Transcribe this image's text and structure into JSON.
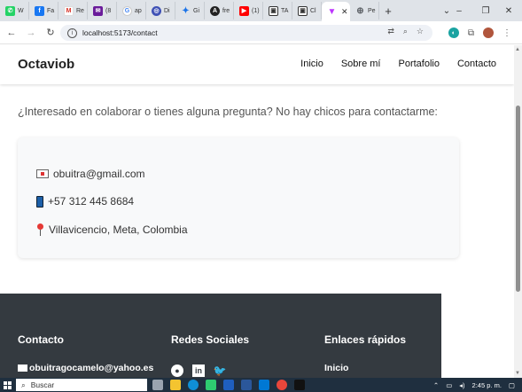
{
  "browser": {
    "tabs": [
      {
        "label": "W",
        "icon": "whatsapp-icon",
        "color": "#25d366"
      },
      {
        "label": "Fa",
        "icon": "facebook-icon",
        "color": "#1877f2"
      },
      {
        "label": "Re",
        "icon": "gmail-icon",
        "color": "#d93025"
      },
      {
        "label": "(8",
        "icon": "mail-icon",
        "color": "#6a1b9a"
      },
      {
        "label": "ap",
        "icon": "google-icon",
        "color": "#4285f4"
      },
      {
        "label": "Di",
        "icon": "site-icon",
        "color": "#3f51b5"
      },
      {
        "label": "Gi",
        "icon": "gemini-icon",
        "color": "#1a73e8"
      },
      {
        "label": "fre",
        "icon": "app-icon",
        "color": "#222222"
      },
      {
        "label": "(1)",
        "icon": "youtube-icon",
        "color": "#ff0000"
      },
      {
        "label": "TA",
        "icon": "doc-icon",
        "color": "#333333"
      },
      {
        "label": "Cl",
        "icon": "doc-icon",
        "color": "#333333"
      },
      {
        "label": "",
        "icon": "vite-icon",
        "color": "#bd34fe",
        "active": true
      },
      {
        "label": "Pe",
        "icon": "globe-icon",
        "color": "#5f6368"
      }
    ],
    "new_tab": "+",
    "window_controls": {
      "chevron": "⌄",
      "minimize": "–",
      "restore": "❐",
      "close": "✕"
    },
    "nav": {
      "back": "←",
      "forward": "→",
      "reload": "↻"
    },
    "url": "localhost:5173/contact"
  },
  "site": {
    "brand": "Octaviob",
    "nav": [
      "Inicio",
      "Sobre mí",
      "Portafolio",
      "Contacto"
    ],
    "intro": "¿Interesado en colaborar o tienes alguna pregunta? No hay chicos para contactarme:",
    "contact": {
      "email": "obuitra@gmail.com",
      "phone": "+57 312 445 8684",
      "location": "Villavicencio, Meta, Colombia"
    },
    "footer": {
      "col1_title": "Contacto",
      "col1_email": "obuitragocamelo@yahoo.es",
      "col2_title": "Redes Sociales",
      "social": [
        "github-icon",
        "linkedin-icon",
        "twitter-icon"
      ],
      "col3_title": "Enlaces rápidos",
      "col3_link": "Inicio"
    }
  },
  "taskbar": {
    "search_placeholder": "Buscar",
    "time": "2:45 p. m."
  },
  "colors": {
    "footer_bg": "#343a40",
    "card_bg": "#f8f9fa",
    "taskbar_bg": "#1f2f3f"
  }
}
